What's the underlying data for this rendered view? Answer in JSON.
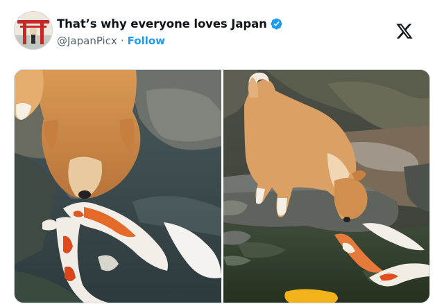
{
  "post": {
    "author": {
      "display_name": "That’s why everyone loves Japan",
      "handle": "@JapanPicx",
      "separator": "·",
      "follow_label": "Follow",
      "verified": true,
      "avatar_icon": "torii-gate-avatar"
    },
    "platform_icon": "x-logo-icon",
    "media": [
      {
        "icon": "photo-shiba-inu-nose-to-koi-closeup"
      },
      {
        "icon": "photo-shiba-inu-standing-over-koi-pond"
      }
    ]
  },
  "colors": {
    "text_primary": "#0f1419",
    "text_secondary": "#536471",
    "accent": "#1d9bf0",
    "border": "#cfd9de"
  }
}
